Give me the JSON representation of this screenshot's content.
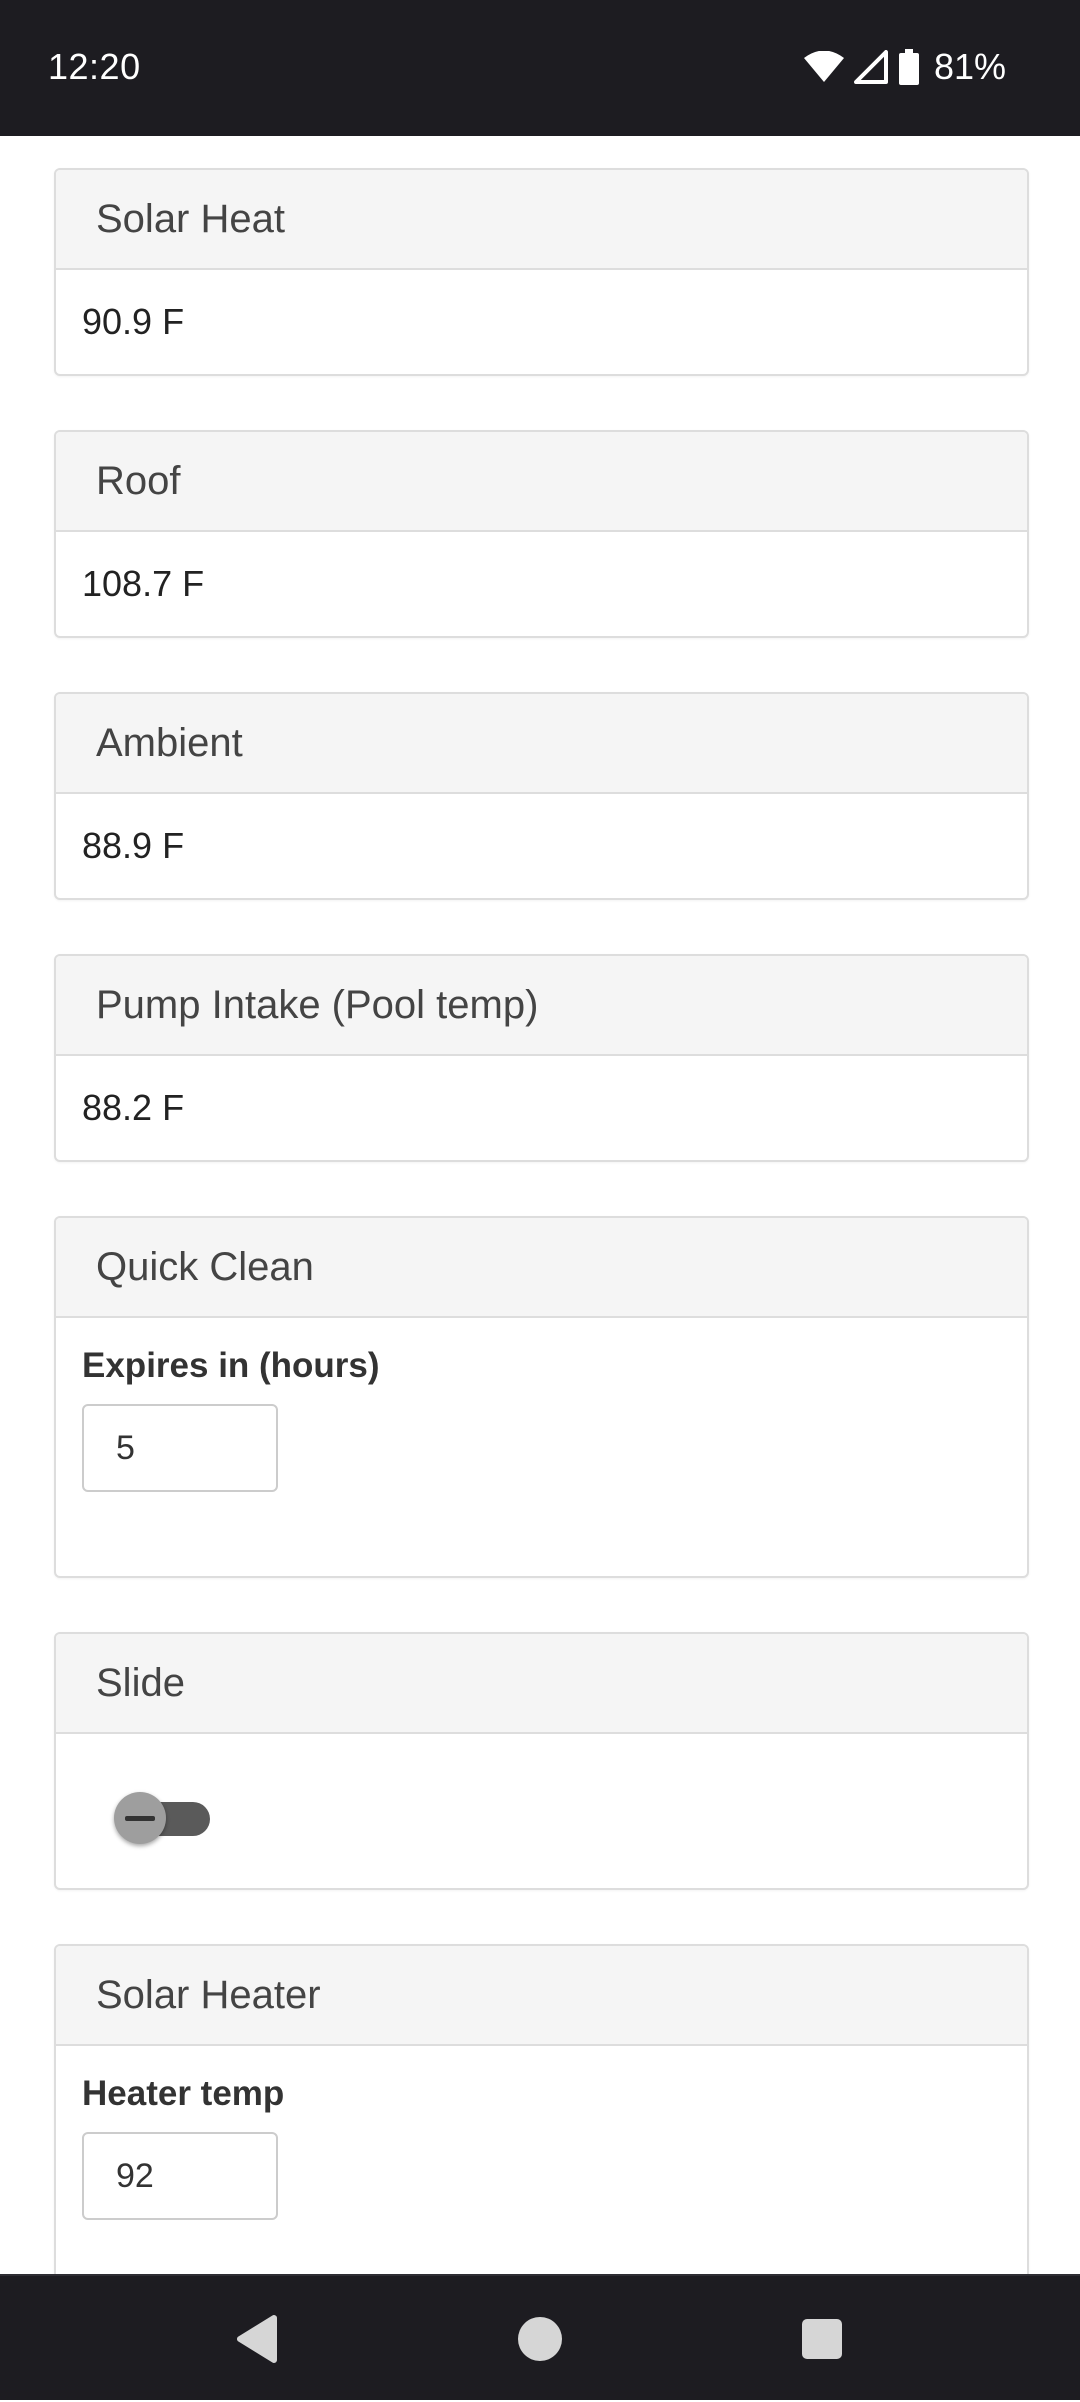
{
  "status_bar": {
    "time": "12:20",
    "battery": "81%",
    "icons": [
      "wifi-icon",
      "cell-signal-icon",
      "battery-icon"
    ]
  },
  "panels": {
    "solar_heat": {
      "title": "Solar Heat",
      "value": "90.9 F"
    },
    "roof": {
      "title": "Roof",
      "value": "108.7 F"
    },
    "ambient": {
      "title": "Ambient",
      "value": "88.9 F"
    },
    "pump_intake": {
      "title": "Pump Intake (Pool temp)",
      "value": "88.2 F"
    },
    "quick_clean": {
      "title": "Quick Clean",
      "label": "Expires in (hours)",
      "value": "5"
    },
    "slide": {
      "title": "Slide",
      "enabled": false
    },
    "solar_heater": {
      "title": "Solar Heater",
      "label": "Heater temp",
      "value": "92"
    }
  },
  "nav_bar": {
    "icons": [
      "back-icon",
      "home-icon",
      "recents-icon"
    ]
  },
  "colors": {
    "system_bar": "#1d1c21",
    "panel_heading_bg": "#f5f5f5",
    "panel_border": "#dddddd",
    "switch_track": "#5a5a5a",
    "switch_thumb": "#9e9e9e"
  }
}
